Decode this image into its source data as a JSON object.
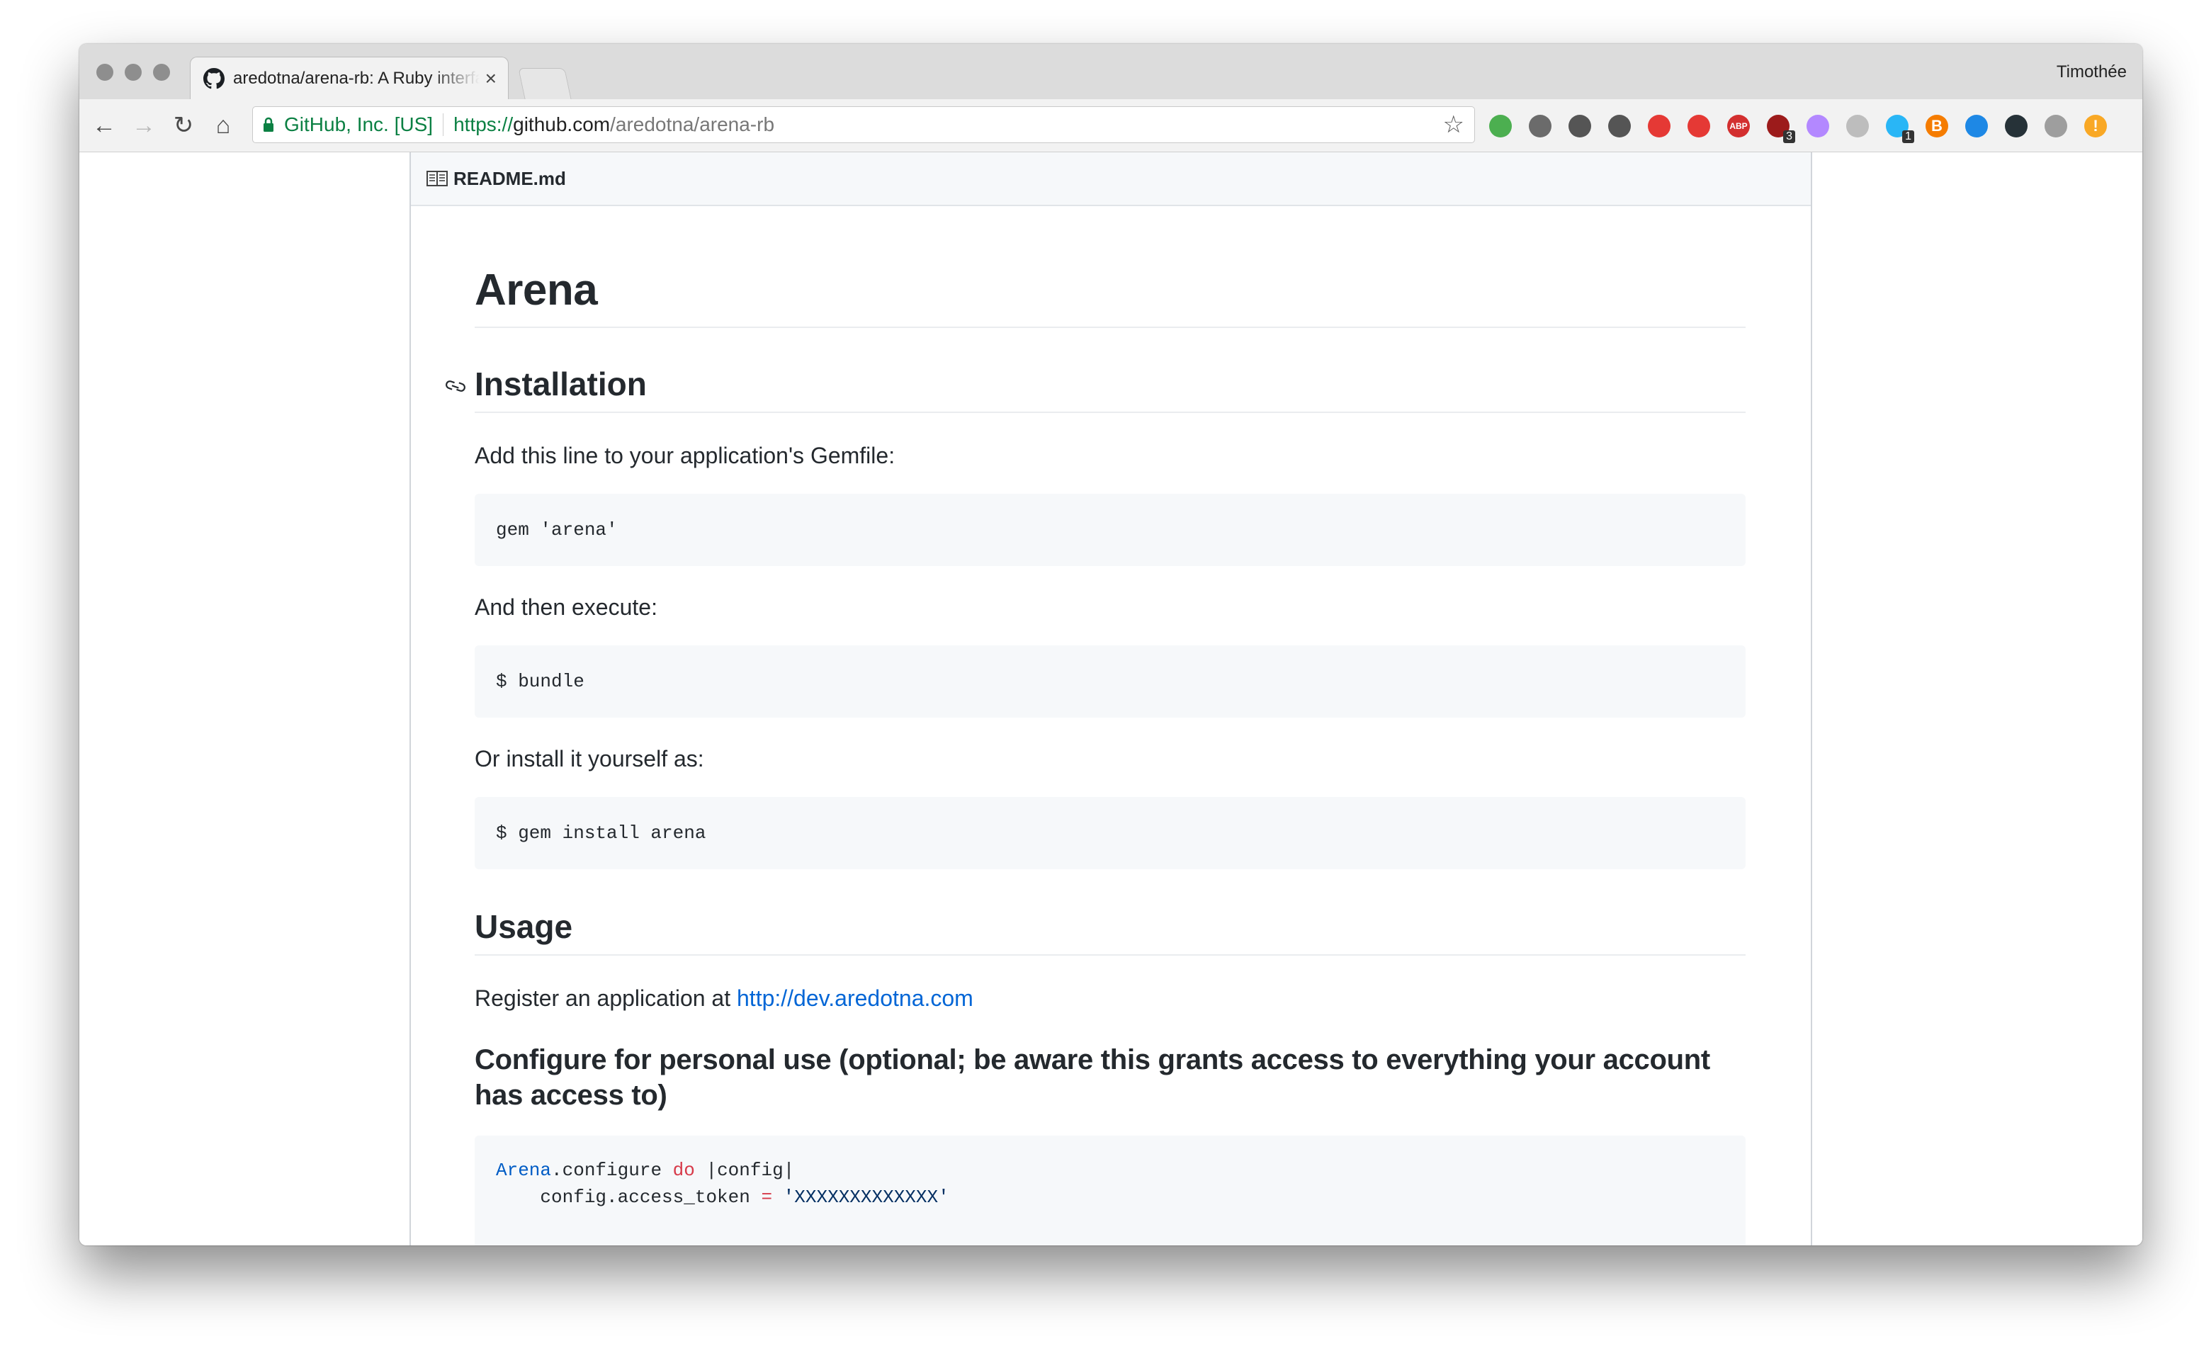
{
  "browser": {
    "tab": {
      "title": "aredotna/arena-rb: A Ruby interface to the Are.na API",
      "close": "×"
    },
    "profile_name": "Timothée",
    "nav": {
      "back": "←",
      "forward": "→",
      "reload": "↻",
      "home": "⌂"
    },
    "address_bar": {
      "site_identity": "GitHub, Inc. [US]",
      "scheme": "https://",
      "host": "github.com",
      "path": "/aredotna/arena-rb",
      "star": "☆"
    },
    "extensions": [
      {
        "name": "green-search-extension-icon",
        "color": "#4caf50"
      },
      {
        "name": "cast-icon",
        "color": "#6b6b6b"
      },
      {
        "name": "1password-icon",
        "color": "#555555"
      },
      {
        "name": "keyhole-extension-icon",
        "color": "#555555"
      },
      {
        "name": "plus-cross-extension-icon",
        "color": "#e53935"
      },
      {
        "name": "red-circle-extension-icon",
        "color": "#e53935"
      },
      {
        "name": "adblock-plus-icon",
        "label": "ABP",
        "color": "#d32f2f"
      },
      {
        "name": "ublock-icon",
        "badge": "3",
        "color": "#9c1b1b"
      },
      {
        "name": "feather-extension-icon",
        "color": "#b388ff"
      },
      {
        "name": "dashed-circle-extension-icon",
        "color": "#bdbdbd"
      },
      {
        "name": "pin-extension-icon",
        "badge": "1",
        "color": "#29b6f6"
      },
      {
        "name": "blogger-extension-icon",
        "label": "B",
        "color": "#f57c00"
      },
      {
        "name": "wave-extension-icon",
        "color": "#1e88e5"
      },
      {
        "name": "dark-lens-extension-icon",
        "color": "#263238"
      },
      {
        "name": "camera-extension-icon",
        "color": "#9e9e9e"
      },
      {
        "name": "warning-extension-icon",
        "label": "!",
        "color": "#f9a825"
      }
    ]
  },
  "readme": {
    "filename": "README.md",
    "title": "Arena",
    "installation": {
      "heading": "Installation",
      "intro": "Add this line to your application's Gemfile:",
      "code1": "gem 'arena'",
      "then": "And then execute:",
      "code2": "$ bundle",
      "or": "Or install it yourself as:",
      "code3": "$ gem install arena"
    },
    "usage": {
      "heading": "Usage",
      "register_prefix": "Register an application at ",
      "register_link": "http://dev.aredotna.com",
      "personal_heading": "Configure for personal use (optional; be aware this grants access to everything your account has access to)",
      "code": {
        "line1_const": "Arena",
        "line1_method": ".configure ",
        "line1_do": "do",
        "line1_block": " |config|",
        "line2_prefix": "    config.access_token ",
        "line2_op": "=",
        "line2_value": " 'XXXXXXXXXXXXX'"
      }
    }
  }
}
